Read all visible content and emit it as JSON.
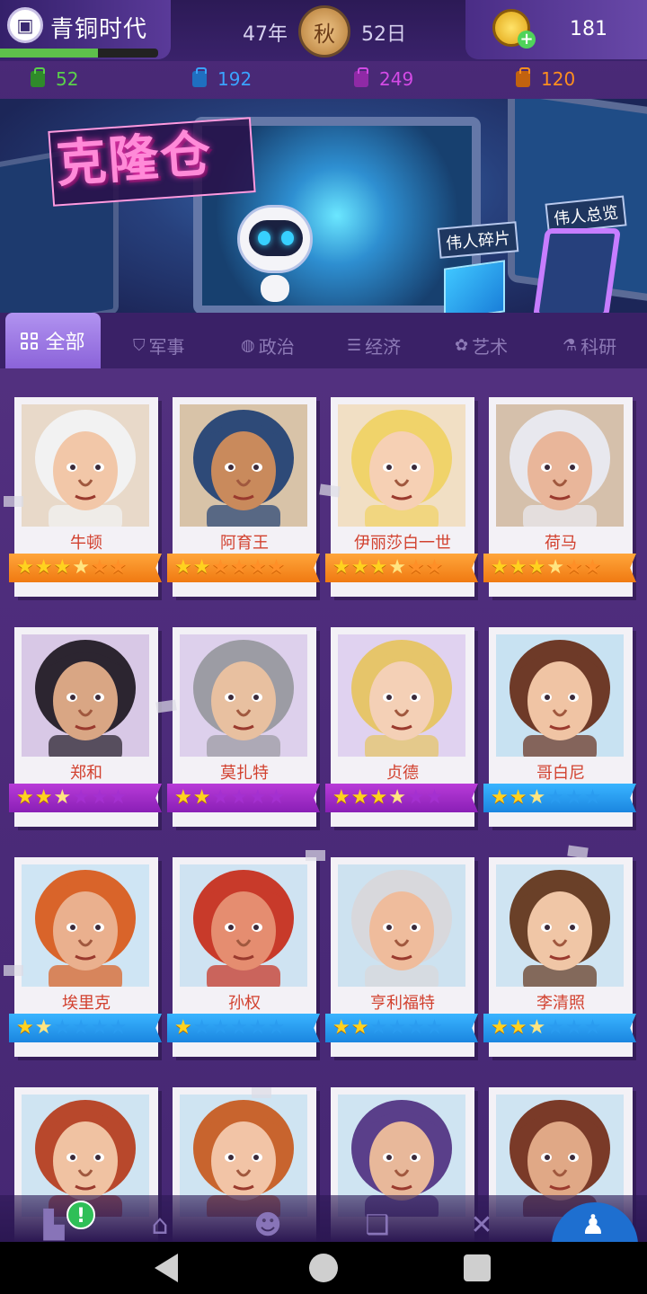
{
  "header": {
    "era_title": "青铜时代",
    "era_progress": 0.62,
    "year": "47年",
    "season": "秋",
    "day": "52日",
    "coins": "181"
  },
  "resources": [
    {
      "icon": "green-supply-icon",
      "value": "52",
      "color": "#5ad14a"
    },
    {
      "icon": "blue-supply-icon",
      "value": "192",
      "color": "#3aa3ff"
    },
    {
      "icon": "purple-supply-icon",
      "value": "249",
      "color": "#d34ae5"
    },
    {
      "icon": "orange-supply-icon",
      "value": "120",
      "color": "#ff8f1e"
    }
  ],
  "banner": {
    "title": "克隆仓",
    "fragments_label": "伟人碎片",
    "overview_label": "伟人总览"
  },
  "tabs": [
    {
      "label": "全部",
      "icon": "grid-icon",
      "active": true
    },
    {
      "label": "军事",
      "icon": "shield-icon"
    },
    {
      "label": "政治",
      "icon": "globe-icon"
    },
    {
      "label": "经济",
      "icon": "coins-icon"
    },
    {
      "label": "艺术",
      "icon": "palette-icon"
    },
    {
      "label": "科研",
      "icon": "flask-icon"
    }
  ],
  "heroes": [
    {
      "name": "牛顿",
      "tier": "orange",
      "stars": 3.5,
      "skin": "#f2c7a8",
      "hair": "#f2f2f2",
      "bg": "#e8d9c9"
    },
    {
      "name": "阿育王",
      "tier": "orange",
      "stars": 2,
      "skin": "#c98a5c",
      "hair": "#2e4a78",
      "bg": "#d8c3a8"
    },
    {
      "name": "伊丽莎白一世",
      "tier": "orange",
      "stars": 3.5,
      "skin": "#f6d0b4",
      "hair": "#f0d36a",
      "bg": "#f1dfc4"
    },
    {
      "name": "荷马",
      "tier": "orange",
      "stars": 3.5,
      "skin": "#e9b69a",
      "hair": "#e8e8ee",
      "bg": "#d5c0ab"
    },
    {
      "name": "郑和",
      "tier": "purple",
      "stars": 2.5,
      "skin": "#d9a684",
      "hair": "#2c2530",
      "bg": "#d8c8e6"
    },
    {
      "name": "莫扎特",
      "tier": "purple",
      "stars": 2,
      "skin": "#e8c0a0",
      "hair": "#9c9ca4",
      "bg": "#ddd0ec"
    },
    {
      "name": "贞德",
      "tier": "purple",
      "stars": 3.5,
      "skin": "#f4d0b6",
      "hair": "#e6c56a",
      "bg": "#e0d2f0"
    },
    {
      "name": "哥白尼",
      "tier": "blue",
      "stars": 2.5,
      "skin": "#f0c4a4",
      "hair": "#6e3a28",
      "bg": "#c8e2f2"
    },
    {
      "name": "埃里克",
      "tier": "blue",
      "stars": 1.5,
      "skin": "#eab08e",
      "hair": "#d9642a",
      "bg": "#cfe5f4"
    },
    {
      "name": "孙权",
      "tier": "blue",
      "stars": 1,
      "skin": "#e58d70",
      "hair": "#c83a2a",
      "bg": "#cfe3f2"
    },
    {
      "name": "亨利福特",
      "tier": "blue",
      "stars": 2,
      "skin": "#efbc9c",
      "hair": "#d8d8dc",
      "bg": "#cde2f0"
    },
    {
      "name": "李清照",
      "tier": "blue",
      "stars": 2.5,
      "skin": "#f0c6a6",
      "hair": "#6a4028",
      "bg": "#cfe4f2"
    }
  ],
  "partial_heroes": [
    {
      "skin": "#f0c2a2",
      "hair": "#b8482c",
      "bg": "#cfe4f2"
    },
    {
      "skin": "#f2c4a6",
      "hair": "#c8642e",
      "bg": "#cfe4f2"
    },
    {
      "skin": "#e8b89a",
      "hair": "#5a3f8a",
      "bg": "#cfe4f2"
    },
    {
      "skin": "#e0a886",
      "hair": "#7a3a28",
      "bg": "#cfe4f2"
    }
  ],
  "bottom_nav": [
    {
      "icon": "factory-icon",
      "badge": "!"
    },
    {
      "icon": "home-icon"
    },
    {
      "icon": "people-icon"
    },
    {
      "icon": "book-icon"
    },
    {
      "icon": "ribbon-icon"
    },
    {
      "icon": "person-icon",
      "active": true
    }
  ]
}
